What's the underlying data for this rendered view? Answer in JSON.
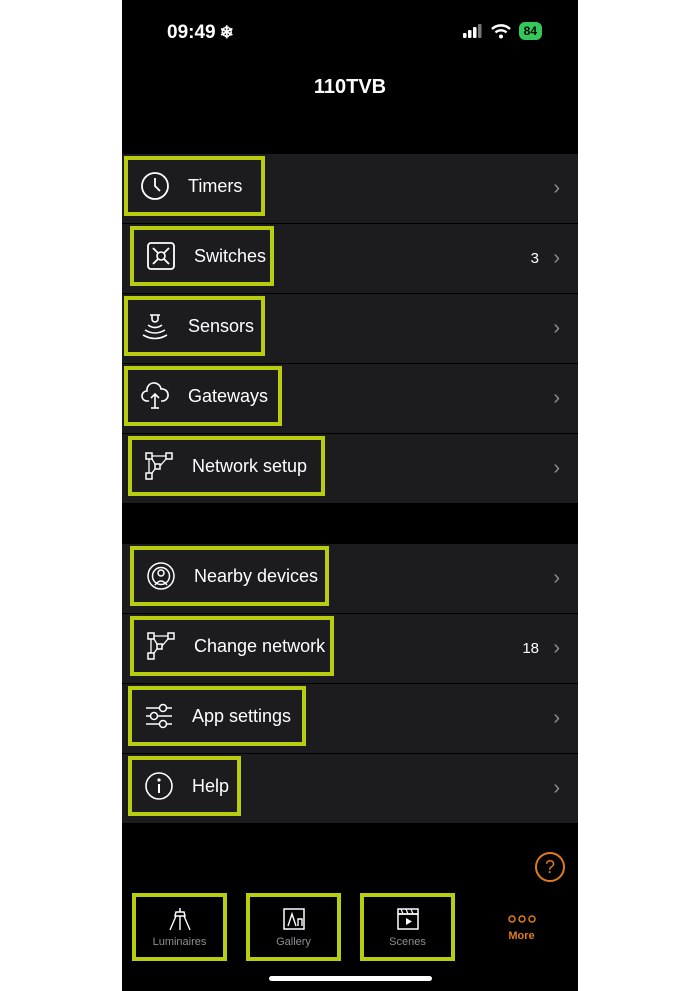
{
  "status_bar": {
    "time": "09:49",
    "battery": "84"
  },
  "header": {
    "title": "110TVB"
  },
  "groups": [
    {
      "items": [
        {
          "label": "Timers",
          "count": ""
        },
        {
          "label": "Switches",
          "count": "3"
        },
        {
          "label": "Sensors",
          "count": ""
        },
        {
          "label": "Gateways",
          "count": ""
        },
        {
          "label": "Network setup",
          "count": ""
        }
      ]
    },
    {
      "items": [
        {
          "label": "Nearby devices",
          "count": ""
        },
        {
          "label": "Change network",
          "count": "18"
        },
        {
          "label": "App settings",
          "count": ""
        },
        {
          "label": "Help",
          "count": ""
        }
      ]
    }
  ],
  "tab_bar": {
    "tabs": [
      {
        "label": "Luminaires",
        "icon": "luminaire-icon"
      },
      {
        "label": "Gallery",
        "icon": "gallery-icon"
      },
      {
        "label": "Scenes",
        "icon": "scenes-icon"
      },
      {
        "label": "More",
        "icon": "more-dots-icon"
      }
    ],
    "active": "More"
  },
  "colors": {
    "highlight": "#b8cc10",
    "accent": "#e07a1f",
    "row_bg": "#1c1c1e"
  }
}
